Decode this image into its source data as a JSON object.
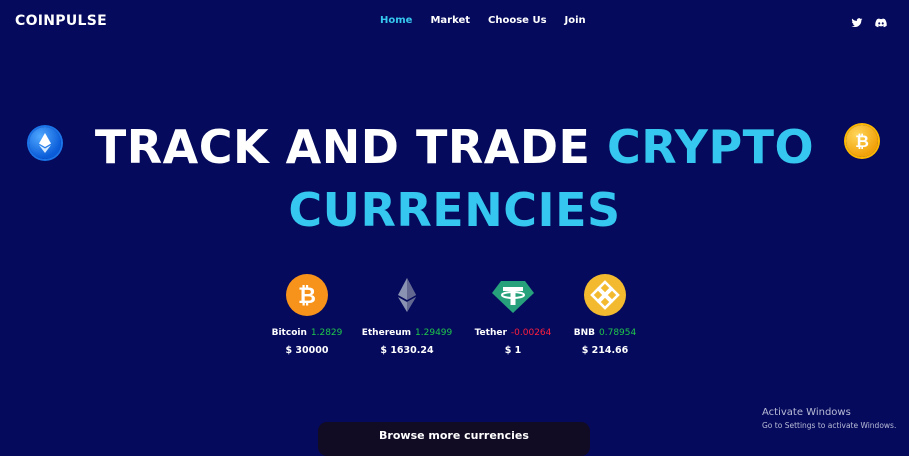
{
  "brand": "COINPULSE",
  "nav": {
    "items": [
      {
        "label": "Home",
        "active": true
      },
      {
        "label": "Market",
        "active": false
      },
      {
        "label": "Choose Us",
        "active": false
      },
      {
        "label": "Join",
        "active": false
      }
    ]
  },
  "social": {
    "icons": [
      "twitter-icon",
      "discord-icon"
    ]
  },
  "hero": {
    "title_plain": "TRACK AND TRADE ",
    "title_accent_1": "CRYPTO",
    "title_accent_2": "CURRENCIES"
  },
  "coins": [
    {
      "name": "Bitcoin",
      "change": "1.2829",
      "direction": "up",
      "price": "$ 30000",
      "icon": "bitcoin-icon"
    },
    {
      "name": "Ethereum",
      "change": "1.29499",
      "direction": "up",
      "price": "$ 1630.24",
      "icon": "ethereum-icon"
    },
    {
      "name": "Tether",
      "change": "-0.00264",
      "direction": "down",
      "price": "$ 1",
      "icon": "tether-icon"
    },
    {
      "name": "BNB",
      "change": "0.78954",
      "direction": "up",
      "price": "$ 214.66",
      "icon": "bnb-icon"
    }
  ],
  "browse_button": "Browse more currencies",
  "watermark": {
    "title": "Activate Windows",
    "subtitle": "Go to Settings to activate Windows."
  },
  "colors": {
    "background": "#050a5c",
    "accent": "#35c7ef",
    "positive": "#1fc74a",
    "negative": "#ff1f3c"
  }
}
